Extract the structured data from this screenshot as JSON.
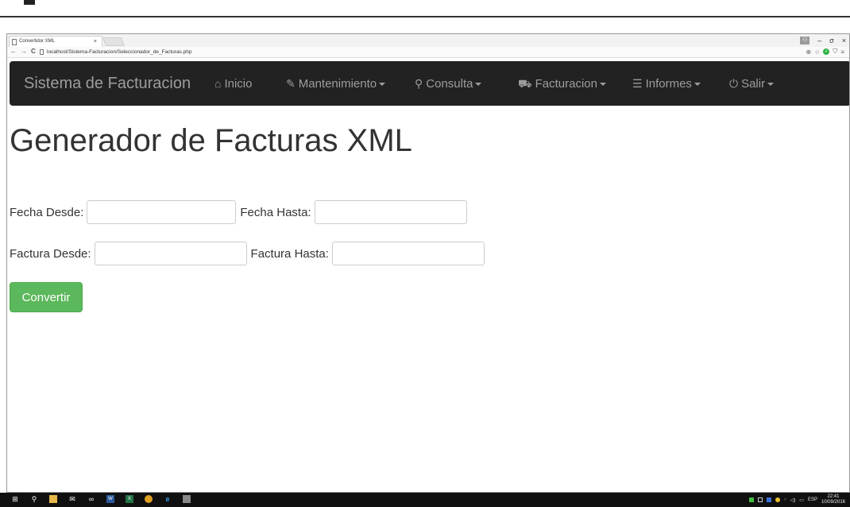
{
  "browser": {
    "tab_title": "Convertidor XML",
    "tab_close": "×",
    "url": "localhost/Sistema-Facturacion/Seleccionador_de_Facturas.php",
    "window_controls": {
      "minimize": "–",
      "maximize": "σ",
      "close": "×"
    }
  },
  "navbar": {
    "brand": "Sistema de Facturacion",
    "items": [
      {
        "label": "Inicio",
        "icon": "home-icon",
        "dropdown": false
      },
      {
        "label": "Mantenimiento",
        "icon": "wrench-icon",
        "dropdown": true
      },
      {
        "label": "Consulta",
        "icon": "search-icon",
        "dropdown": true
      },
      {
        "label": "Facturacion",
        "icon": "cart-icon",
        "dropdown": true
      },
      {
        "label": "Informes",
        "icon": "list-icon",
        "dropdown": true
      },
      {
        "label": "Salir",
        "icon": "power-icon",
        "dropdown": true
      }
    ],
    "colors": {
      "background": "#222222",
      "text": "#9d9d9d"
    }
  },
  "main": {
    "title": "Generador de Facturas XML",
    "fecha_desde_label": "Fecha Desde:",
    "fecha_desde_value": "",
    "fecha_hasta_label": "Fecha Hasta:",
    "fecha_hasta_value": "",
    "factura_desde_label": "Factura Desde:",
    "factura_desde_value": "",
    "factura_hasta_label": "Factura Hasta:",
    "factura_hasta_value": "",
    "convert_button": "Convertir",
    "button_color": "#5cb85c"
  },
  "taskbar": {
    "time": "22:41",
    "date": "10/09/2016",
    "language": "ESP"
  }
}
